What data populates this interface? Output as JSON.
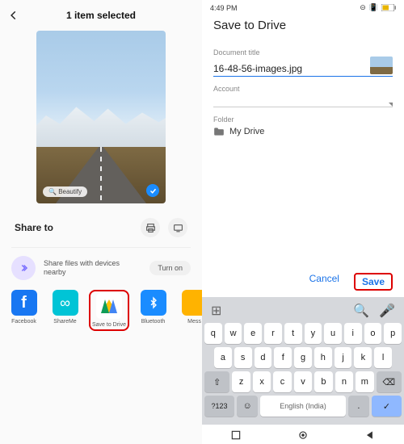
{
  "left": {
    "header_title": "1 item selected",
    "beautify_chip": "Beautify",
    "share_label": "Share to",
    "nearby_text": "Share files with devices nearby",
    "turn_on": "Turn on",
    "apps": [
      {
        "label": "Facebook"
      },
      {
        "label": "ShareMe"
      },
      {
        "label": "Save to Drive"
      },
      {
        "label": "Bluetooth"
      },
      {
        "label": "Mess"
      }
    ]
  },
  "right": {
    "status_time": "4:49 PM",
    "title": "Save to Drive",
    "doc_label": "Document title",
    "doc_value": "16-48-56-images.jpg",
    "account_label": "Account",
    "folder_label": "Folder",
    "folder_value": "My Drive",
    "cancel": "Cancel",
    "save": "Save"
  },
  "keyboard": {
    "row1": [
      "q",
      "w",
      "e",
      "r",
      "t",
      "y",
      "u",
      "i",
      "o",
      "p"
    ],
    "row2": [
      "a",
      "s",
      "d",
      "f",
      "g",
      "h",
      "j",
      "k",
      "l"
    ],
    "sym": "?123",
    "lang": "English (India)"
  }
}
